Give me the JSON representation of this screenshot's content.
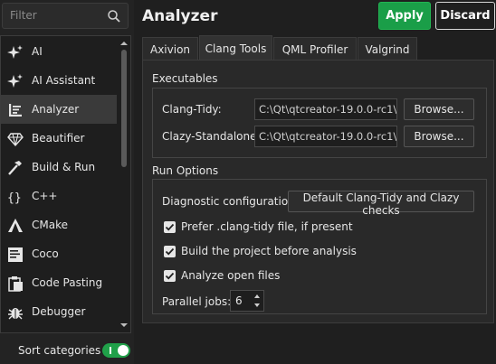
{
  "sidebar": {
    "filter_placeholder": "Filter",
    "categories": [
      {
        "label": "AI",
        "icon": "sparkle-icon"
      },
      {
        "label": "AI Assistant",
        "icon": "sparkle-icon"
      },
      {
        "label": "Analyzer",
        "icon": "analyzer-icon",
        "selected": true
      },
      {
        "label": "Beautifier",
        "icon": "diamond-icon"
      },
      {
        "label": "Build & Run",
        "icon": "hammer-icon"
      },
      {
        "label": "C++",
        "icon": "braces-icon"
      },
      {
        "label": "CMake",
        "icon": "cmake-icon"
      },
      {
        "label": "Coco",
        "icon": "coco-icon"
      },
      {
        "label": "Code Pasting",
        "icon": "clipboard-icon"
      },
      {
        "label": "Debugger",
        "icon": "bug-icon"
      }
    ],
    "sort_label": "Sort categories",
    "sort_enabled": true
  },
  "header": {
    "title": "Analyzer",
    "apply_label": "Apply",
    "discard_label": "Discard"
  },
  "tabs": [
    {
      "label": "Axivion"
    },
    {
      "label": "Clang Tools",
      "active": true
    },
    {
      "label": "QML Profiler"
    },
    {
      "label": "Valgrind"
    }
  ],
  "executables": {
    "section_label": "Executables",
    "clang_tidy_label": "Clang-Tidy:",
    "clang_tidy_path": "C:\\Qt\\qtcreator-19.0.0-rc1\\...",
    "clazy_label": "Clazy-Standalone:",
    "clazy_path": "C:\\Qt\\qtcreator-19.0.0-rc1\\...",
    "browse_label": "Browse..."
  },
  "run_options": {
    "section_label": "Run Options",
    "diag_label": "Diagnostic configuration:",
    "diag_value": "Default Clang-Tidy and Clazy checks",
    "prefer_label": "Prefer .clang-tidy file, if present",
    "build_label": "Build the project before analysis",
    "analyze_label": "Analyze open files",
    "parallel_label": "Parallel jobs:",
    "parallel_value": "6"
  },
  "colors": {
    "accent_green": "#1a9e48",
    "background": "#1f1f1f",
    "selected_item": "#3a3a3a"
  }
}
